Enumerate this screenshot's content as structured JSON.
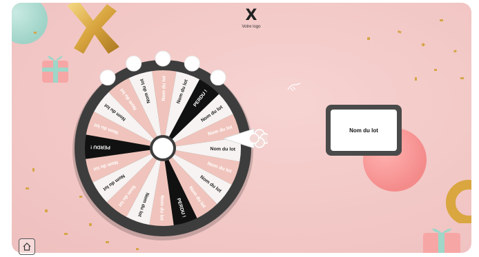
{
  "logo": {
    "mark": "X",
    "text": "Votre logo"
  },
  "wheel": {
    "segments": [
      {
        "label": "PERDU !",
        "type": "lose"
      },
      {
        "label": "Nom du lot",
        "type": "white"
      },
      {
        "label": "Nom du lot",
        "type": "pink"
      },
      {
        "label": "Nom du lot",
        "type": "white"
      },
      {
        "label": "Nom du lot",
        "type": "pink"
      },
      {
        "label": "Nom du lot",
        "type": "white"
      },
      {
        "label": "Nom du lot",
        "type": "pink"
      },
      {
        "label": "PERDU !",
        "type": "lose"
      },
      {
        "label": "Nom du lot",
        "type": "pink"
      },
      {
        "label": "Nom du lot",
        "type": "white"
      },
      {
        "label": "Nom du lot",
        "type": "pink"
      },
      {
        "label": "Nom du lot",
        "type": "white"
      },
      {
        "label": "Nom du lot",
        "type": "pink"
      },
      {
        "label": "PERDU !",
        "type": "lose"
      },
      {
        "label": "Nom du lot",
        "type": "pink"
      },
      {
        "label": "Nom du lot",
        "type": "white"
      },
      {
        "label": "Nom du lot",
        "type": "pink"
      },
      {
        "label": "Nom du lot",
        "type": "white"
      },
      {
        "label": "Nom du lot",
        "type": "pink"
      },
      {
        "label": "Nom du lot",
        "type": "white"
      }
    ],
    "colors": {
      "pink": "#f0c4bc",
      "white": "#f6f3f2",
      "lose": "#111111",
      "rim": "#3d3d3d"
    },
    "lights_count": 5
  },
  "prize": {
    "label": "Nom du lot"
  },
  "icons": {
    "pointer": "clover-pointer-icon",
    "hand": "hand-cursor-icon",
    "corner": "home-icon"
  }
}
